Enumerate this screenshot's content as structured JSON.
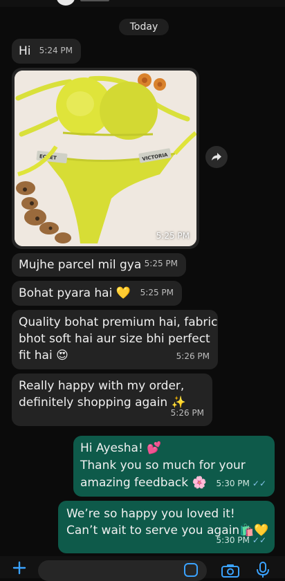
{
  "chat": {
    "date_chip": "Today",
    "messages": [
      {
        "text": "Hi",
        "time": "5:24 PM"
      },
      {
        "image_time": "5:25 PM"
      },
      {
        "text": "Mujhe parcel mil gya",
        "time": "5:25 PM"
      },
      {
        "text": "Bohat pyara hai 💛",
        "time": "5:25 PM"
      },
      {
        "line1": "Quality bohat premium hai, fabric",
        "line2": "bhot soft hai aur size bhi perfect",
        "line3": "fit hai 😍",
        "time": "5:26 PM"
      },
      {
        "line1": "Really happy with my order,",
        "line2": "definitely shopping again ✨",
        "time": "5:26 PM"
      },
      {
        "line1": "Hi Ayesha! 💕",
        "line2": "Thank you so much for your",
        "line3": "amazing feedback 🌸",
        "time": "5:30 PM"
      },
      {
        "line1": "We’re so happy you loved it!",
        "line2": "Can’t wait to serve you again🛍️💛",
        "time": "5:30 PM"
      }
    ]
  },
  "colors": {
    "incoming_bubble": "#232323",
    "outgoing_bubble": "#0e5a4a",
    "accent_blue": "#3aa3ff"
  },
  "icons": {
    "forward": "forward-arrow-icon",
    "plus": "plus-icon",
    "sticker": "sticker-icon",
    "camera": "camera-icon",
    "mic": "microphone-icon",
    "read": "double-check-icon"
  }
}
